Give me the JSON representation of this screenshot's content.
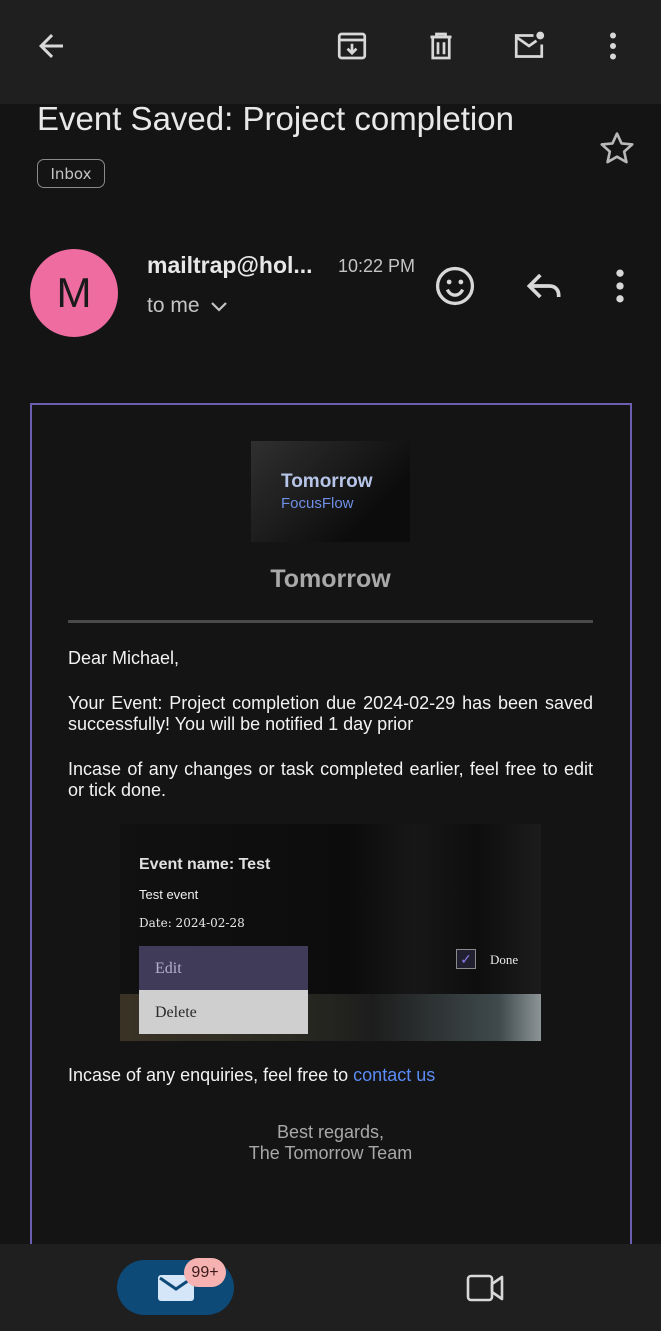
{
  "toolbar": {
    "back_icon": "arrow-left-icon",
    "archive_icon": "archive-icon",
    "delete_icon": "trash-icon",
    "mark_unread_icon": "mail-unread-icon",
    "more_icon": "more-vert-icon"
  },
  "email": {
    "subject": "Event Saved: Project completion",
    "label": "Inbox",
    "sender_initial": "M",
    "sender": "mailtrap@hol...",
    "time": "10:22 PM",
    "recipient": "to me",
    "avatar_color": "#ee6ca0"
  },
  "body": {
    "logo_title": "Tomorrow",
    "logo_subtitle": "FocusFlow",
    "brand": "Tomorrow",
    "greeting": "Dear Michael,",
    "para1": "Your Event: Project completion due 2024-02-29 has been saved successfully! You will be notified 1 day prior",
    "para2": "Incase of any changes or task completed earlier, feel free to edit or tick done.",
    "screenshot": {
      "event_name": "Event name: Test",
      "description": "Test event",
      "date": "Date: 2024-02-28",
      "edit_label": "Edit",
      "delete_label": "Delete",
      "check_mark": "✓",
      "done_label": "Done"
    },
    "enquiry_prefix": "Incase of any enquiries, feel free to ",
    "contact_link": "contact us",
    "regards": "Best regards,",
    "team": "The Tomorrow Team"
  },
  "bottom_nav": {
    "mail_badge": "99+",
    "accent": "#0d4a78"
  }
}
